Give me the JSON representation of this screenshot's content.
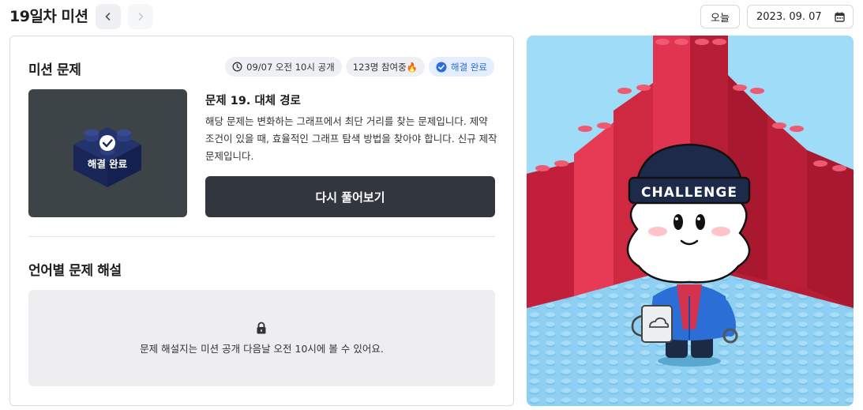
{
  "header": {
    "title": "19일차 미션",
    "today_label": "오늘",
    "date_value": "2023. 09. 07"
  },
  "mission": {
    "section_title": "미션 문제",
    "badges": {
      "open_time": "09/07 오전 10시 공개",
      "participants": "123명 참여중🔥",
      "status": "해결 완료"
    },
    "thumbnail_label": "해결 완료",
    "problem_title": "문제 19. 대체 경로",
    "problem_desc": "해당 문제는 변화하는 그래프에서 최단 거리를 찾는 문제입니다. 제약 조건이 있을 때, 효율적인 그래프 탐색 방법을 찾아야 합니다. 신규 제작 문제입니다.",
    "retry_label": "다시 풀어보기"
  },
  "solutions": {
    "section_title": "언어별 문제 해설",
    "locked_message": "문제 해설지는 미션 공개 다음날 오전 10시에 볼 수 있어요."
  },
  "illustration": {
    "hat_text": "CHALLENGE"
  },
  "colors": {
    "accent_blue": "#2a6be0",
    "dark_button": "#32363f",
    "brick_red": "#d92b45",
    "floor_blue": "#8fd0f2",
    "sky_blue": "#9fdcf7"
  }
}
